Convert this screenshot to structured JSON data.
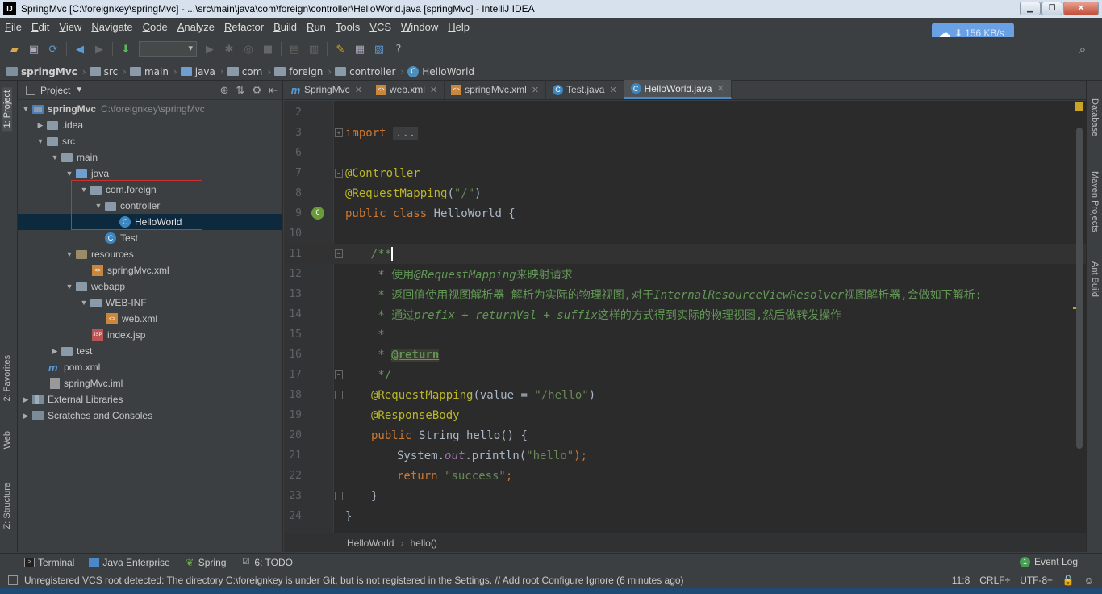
{
  "window": {
    "title": "SpringMvc [C:\\foreignkey\\springMvc] - ...\\src\\main\\java\\com\\foreign\\controller\\HelloWorld.java [springMvc] - IntelliJ IDEA",
    "app_icon_text": "IJ",
    "buttons": {
      "minimize": "▁",
      "restore": "❐",
      "close": "✕"
    }
  },
  "menu": [
    "File",
    "Edit",
    "View",
    "Navigate",
    "Code",
    "Analyze",
    "Refactor",
    "Build",
    "Run",
    "Tools",
    "VCS",
    "Window",
    "Help"
  ],
  "speed_badge": {
    "arrow": "⬇",
    "text": "156 KB/s"
  },
  "breadcrumb": [
    "springMvc",
    "src",
    "main",
    "java",
    "com",
    "foreign",
    "controller",
    "HelloWorld"
  ],
  "left_tool_tabs": {
    "project": "1: Project",
    "favorites": "2: Favorites",
    "web": "Web",
    "structure": "Z: Structure"
  },
  "right_tool_tabs": {
    "database": "Database",
    "maven": "Maven Projects",
    "ant": "Ant Build"
  },
  "project_panel": {
    "title": "Project",
    "tree": [
      {
        "label": "springMvc",
        "extra": "C:\\foreignkey\\springMvc"
      },
      {
        "label": ".idea"
      },
      {
        "label": "src"
      },
      {
        "label": "main"
      },
      {
        "label": "java"
      },
      {
        "label": "com.foreign"
      },
      {
        "label": "controller"
      },
      {
        "label": "HelloWorld"
      },
      {
        "label": "Test"
      },
      {
        "label": "resources"
      },
      {
        "label": "springMvc.xml"
      },
      {
        "label": "webapp"
      },
      {
        "label": "WEB-INF"
      },
      {
        "label": "web.xml"
      },
      {
        "label": "index.jsp"
      },
      {
        "label": "test"
      },
      {
        "label": "pom.xml"
      },
      {
        "label": "springMvc.iml"
      },
      {
        "label": "External Libraries"
      },
      {
        "label": "Scratches and Consoles"
      }
    ]
  },
  "editor_tabs": [
    "SpringMvc",
    "web.xml",
    "springMvc.xml",
    "Test.java",
    "HelloWorld.java"
  ],
  "code": {
    "line_numbers": [
      "2",
      "3",
      "6",
      "7",
      "8",
      "9",
      "10",
      "11",
      "12",
      "13",
      "14",
      "15",
      "16",
      "17",
      "18",
      "19",
      "20",
      "21",
      "22",
      "23",
      "24"
    ],
    "import_kw": "import",
    "import_fold": "...",
    "l7": "@Controller",
    "l8_ann": "@RequestMapping",
    "l8_open": "(",
    "l8_str": "\"/\"",
    "l8_close": ")",
    "l9_kw": "public class",
    "l9_rest": " HelloWorld {",
    "l11": "/**",
    "l12_a": " * 使用",
    "l12_b": "@RequestMapping",
    "l12_c": "来映射请求",
    "l13_a": " * 返回值使用视图解析器 解析为实际的物理视图,对于",
    "l13_b": "InternalResourceViewResolver",
    "l13_c": "视图解析器,会做如下解析:",
    "l14_a": " * 通过",
    "l14_b": "prefix + returnVal + suffix",
    "l14_c": "这样的方式得到实际的物理视图,然后做转发操作",
    "l15": " *",
    "l16_a": " * ",
    "l16_b": "@return",
    "l17": " */",
    "l18_ann": "@RequestMapping",
    "l18_a": "(value = ",
    "l18_str": "\"/hello\"",
    "l18_b": ")",
    "l19": "@ResponseBody",
    "l20_kw": "public",
    "l20_rest": " String hello() {",
    "l21_a": "System.",
    "l21_fld": "out",
    "l21_b": ".println(",
    "l21_str": "\"hello\"",
    "l21_c": ");",
    "l22_kw": "return",
    "l22_str": " \"success\"",
    "l22_c": ";",
    "l23": "}",
    "l24": "}"
  },
  "editor_breadcrumb": [
    "HelloWorld",
    "hello()"
  ],
  "bottom_tools": [
    "Terminal",
    "Java Enterprise",
    "Spring",
    "6: TODO"
  ],
  "event_log": {
    "count": "1",
    "label": "Event Log"
  },
  "status": {
    "message": "Unregistered VCS root detected: The directory C:\\foreignkey is under Git, but is not registered in the Settings. // Add root  Configure  Ignore (6 minutes ago)",
    "position": "11:8",
    "line_sep": "CRLF÷",
    "encoding": "UTF-8÷"
  }
}
